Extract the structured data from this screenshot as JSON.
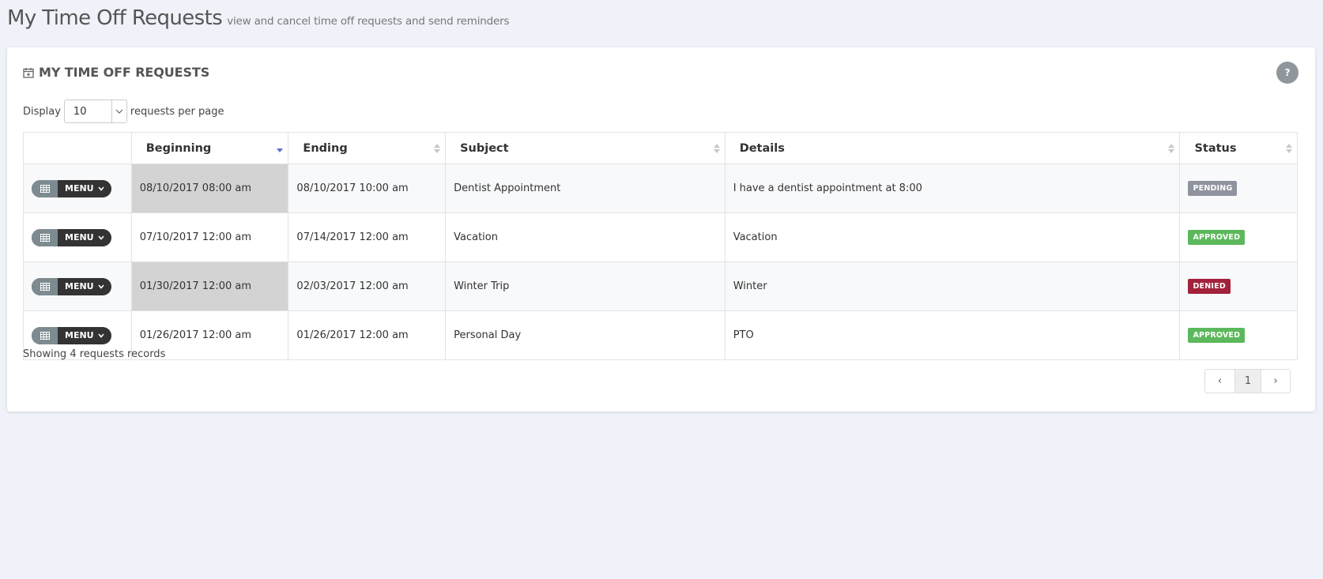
{
  "header": {
    "title": "My Time Off Requests",
    "subtitle": "view and cancel time off requests and send reminders"
  },
  "card": {
    "title": "MY TIME OFF REQUESTS",
    "help_label": "?"
  },
  "display": {
    "prefix": "Display",
    "value": "10",
    "suffix": "requests per page"
  },
  "table": {
    "columns": [
      "",
      "Beginning",
      "Ending",
      "Subject",
      "Details",
      "Status"
    ],
    "menu_label": "MENU",
    "rows": [
      {
        "beginning": "08/10/2017 08:00 am",
        "ending": "08/10/2017 10:00 am",
        "subject": "Dentist Appointment",
        "details": "I have a dentist appointment at 8:00",
        "status": "PENDING",
        "status_color": "#8e939e"
      },
      {
        "beginning": "07/10/2017 12:00 am",
        "ending": "07/14/2017 12:00 am",
        "subject": "Vacation",
        "details": "Vacation",
        "status": "APPROVED",
        "status_color": "#5cb85c"
      },
      {
        "beginning": "01/30/2017 12:00 am",
        "ending": "02/03/2017 12:00 am",
        "subject": "Winter Trip",
        "details": "Winter",
        "status": "DENIED",
        "status_color": "#a3213a"
      },
      {
        "beginning": "01/26/2017 12:00 am",
        "ending": "01/26/2017 12:00 am",
        "subject": "Personal Day",
        "details": "PTO",
        "status": "APPROVED",
        "status_color": "#5cb85c"
      }
    ]
  },
  "footer": {
    "summary": "Showing 4 requests records",
    "pagination": {
      "prev": "‹",
      "current": "1",
      "next": "›"
    }
  },
  "colors": {
    "background": "#eff2f9",
    "menu_icon_bg": "#7d8b91",
    "menu_label_bg": "#333333",
    "sort_active": "#5a6fd0",
    "sorted_cell_highlight": "#d3d3d3"
  },
  "icons": {
    "card_title": "calendar-plus-icon",
    "menu": "table-grid-icon",
    "menu_caret": "chevron-down-icon",
    "sort": "sort-icon"
  }
}
